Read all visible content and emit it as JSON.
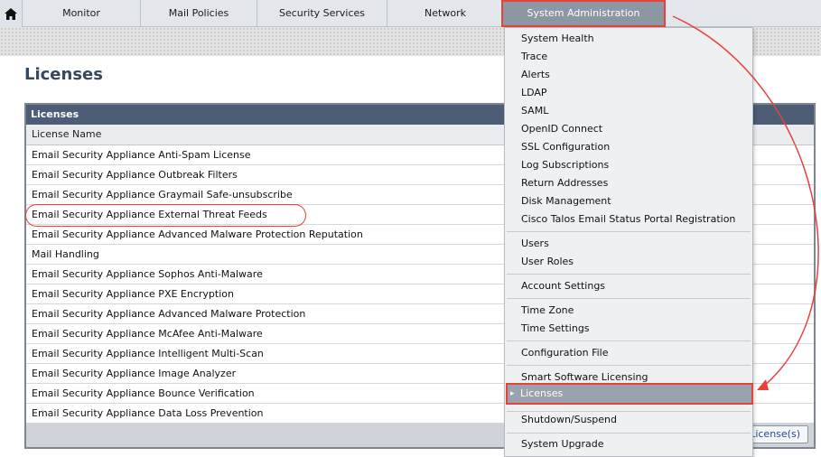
{
  "nav": {
    "home_icon": "home-icon",
    "items": [
      "Monitor",
      "Mail Policies",
      "Security Services",
      "Network",
      "System Administration"
    ]
  },
  "page": {
    "title": "Licenses"
  },
  "table": {
    "header": "Licenses",
    "column": "License Name",
    "rows": [
      "Email Security Appliance Anti-Spam License",
      "Email Security Appliance Outbreak Filters",
      "Email Security Appliance Graymail Safe-unsubscribe",
      "Email Security Appliance External Threat Feeds",
      "Email Security Appliance Advanced Malware Protection Reputation",
      "Mail Handling",
      "Email Security Appliance Sophos Anti-Malware",
      "Email Security Appliance PXE Encryption",
      "Email Security Appliance Advanced Malware Protection",
      "Email Security Appliance McAfee Anti-Malware",
      "Email Security Appliance Intelligent Multi-Scan",
      "Email Security Appliance Image Analyzer",
      "Email Security Appliance Bounce Verification",
      "Email Security Appliance Data Loss Prevention"
    ],
    "button_partial": "License(s)"
  },
  "menu": {
    "items": [
      "System Health",
      "Trace",
      "Alerts",
      "LDAP",
      "SAML",
      "OpenID Connect",
      "SSL Configuration",
      "Log Subscriptions",
      "Return Addresses",
      "Disk Management",
      "Cisco Talos Email Status Portal Registration",
      "Users",
      "User Roles",
      "Account Settings",
      "Time Zone",
      "Time Settings",
      "Configuration File",
      "Smart Software Licensing",
      "Licenses",
      "Shutdown/Suspend",
      "System Upgrade"
    ],
    "active": "Licenses"
  },
  "colors": {
    "highlight": "#e8413a",
    "header": "#4c5d75",
    "active_nav": "#8d97a4"
  }
}
